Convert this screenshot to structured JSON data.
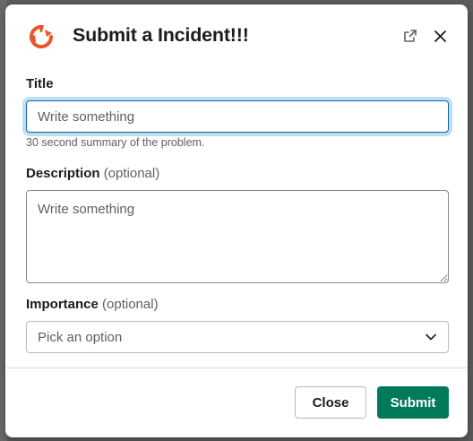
{
  "modal": {
    "title": "Submit a Incident!!!",
    "logo_icon": "incident-logo-icon",
    "logo_color": "#e8562a",
    "header_actions": [
      "open-in-new-window-icon",
      "close-icon"
    ]
  },
  "form": {
    "title_field": {
      "label": "Title",
      "placeholder": "Write something",
      "hint": "30 second summary of the problem."
    },
    "description_field": {
      "label": "Description",
      "optional": "(optional)",
      "placeholder": "Write something"
    },
    "importance_field": {
      "label": "Importance",
      "optional": "(optional)",
      "selected": "Pick an option"
    }
  },
  "footer": {
    "close_label": "Close",
    "submit_label": "Submit",
    "submit_color": "#007a5a"
  }
}
